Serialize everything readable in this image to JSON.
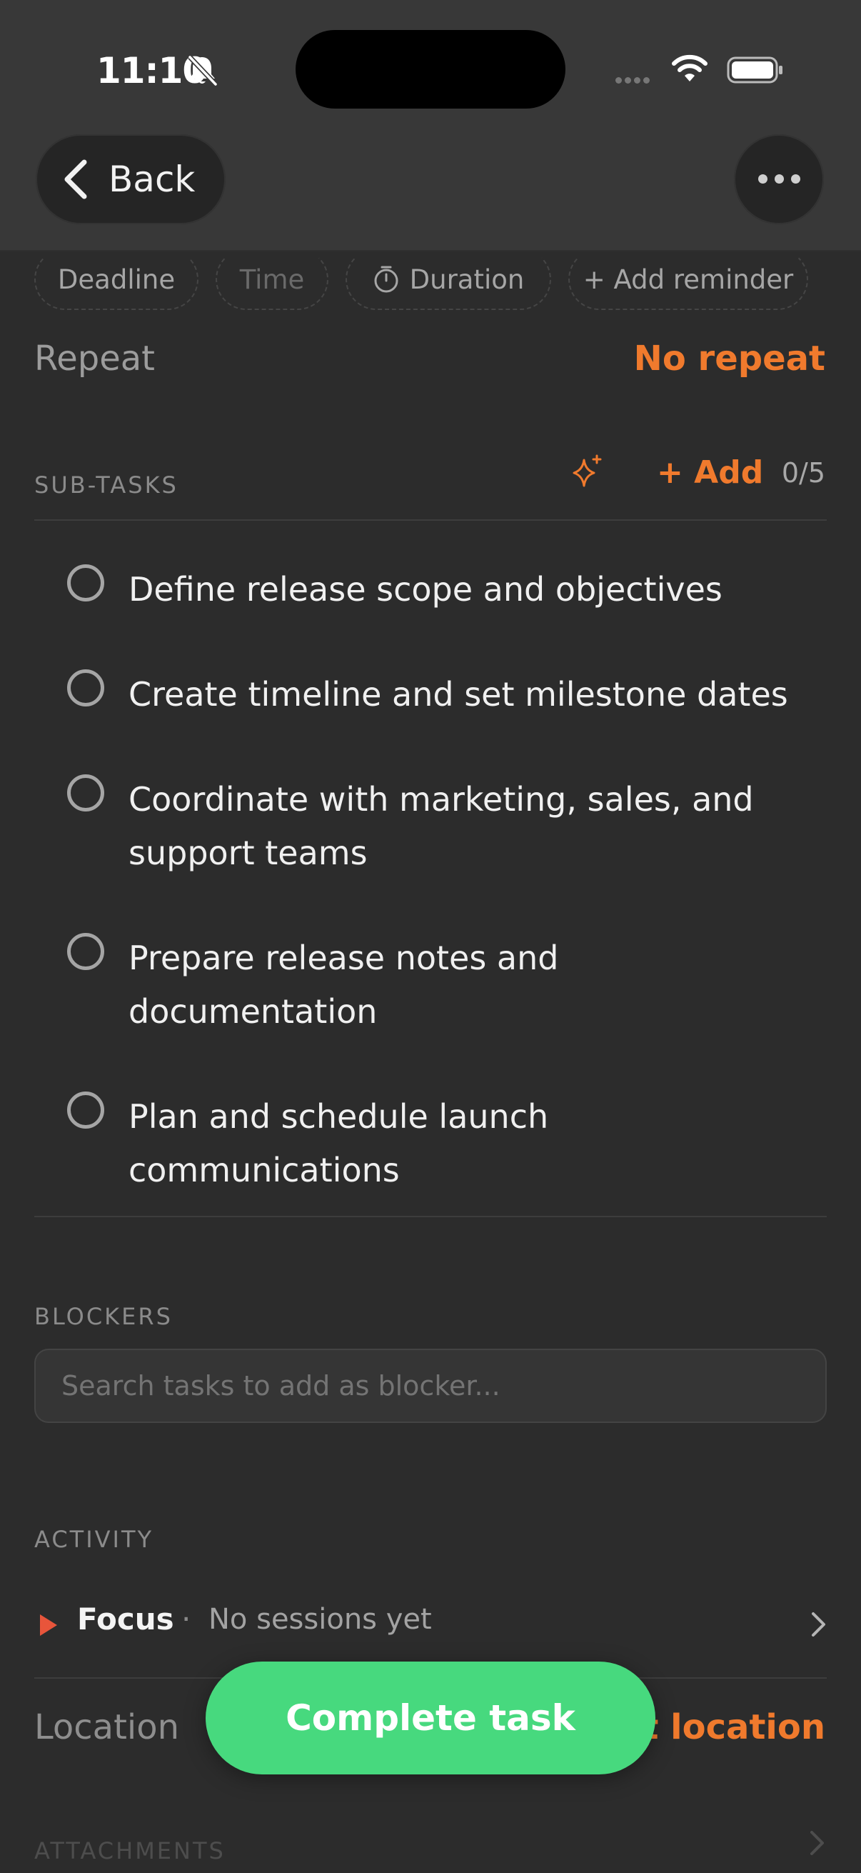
{
  "status_bar": {
    "time": "11:10"
  },
  "header": {
    "back_label": "Back"
  },
  "chips": {
    "deadline": "Deadline",
    "time": "Time",
    "duration": "Duration",
    "add_reminder": "+ Add reminder"
  },
  "repeat": {
    "label": "Repeat",
    "value": "No repeat"
  },
  "subtasks": {
    "title": "SUB-TASKS",
    "add_label": "+ Add",
    "count": "0/5",
    "items": [
      {
        "text": "Define release scope and objectives"
      },
      {
        "text": "Create timeline and set milestone dates"
      },
      {
        "text": "Coordinate with marketing, sales, and support teams"
      },
      {
        "text": "Prepare release notes and documentation"
      },
      {
        "text": "Plan and schedule launch communications"
      }
    ]
  },
  "blockers": {
    "title": "BLOCKERS",
    "placeholder": "Search tasks to add as blocker..."
  },
  "activity": {
    "title": "ACTIVITY",
    "focus_label": "Focus",
    "separator": "·",
    "focus_value": "No sessions yet"
  },
  "location": {
    "label": "Location",
    "value": "Set location"
  },
  "attachments": {
    "title": "ATTACHMENTS"
  },
  "complete_button": {
    "label": "Complete task"
  },
  "colors": {
    "accent": "#f07a2d",
    "complete": "#47d97e",
    "background": "#2c2c2c",
    "header": "#383838"
  }
}
